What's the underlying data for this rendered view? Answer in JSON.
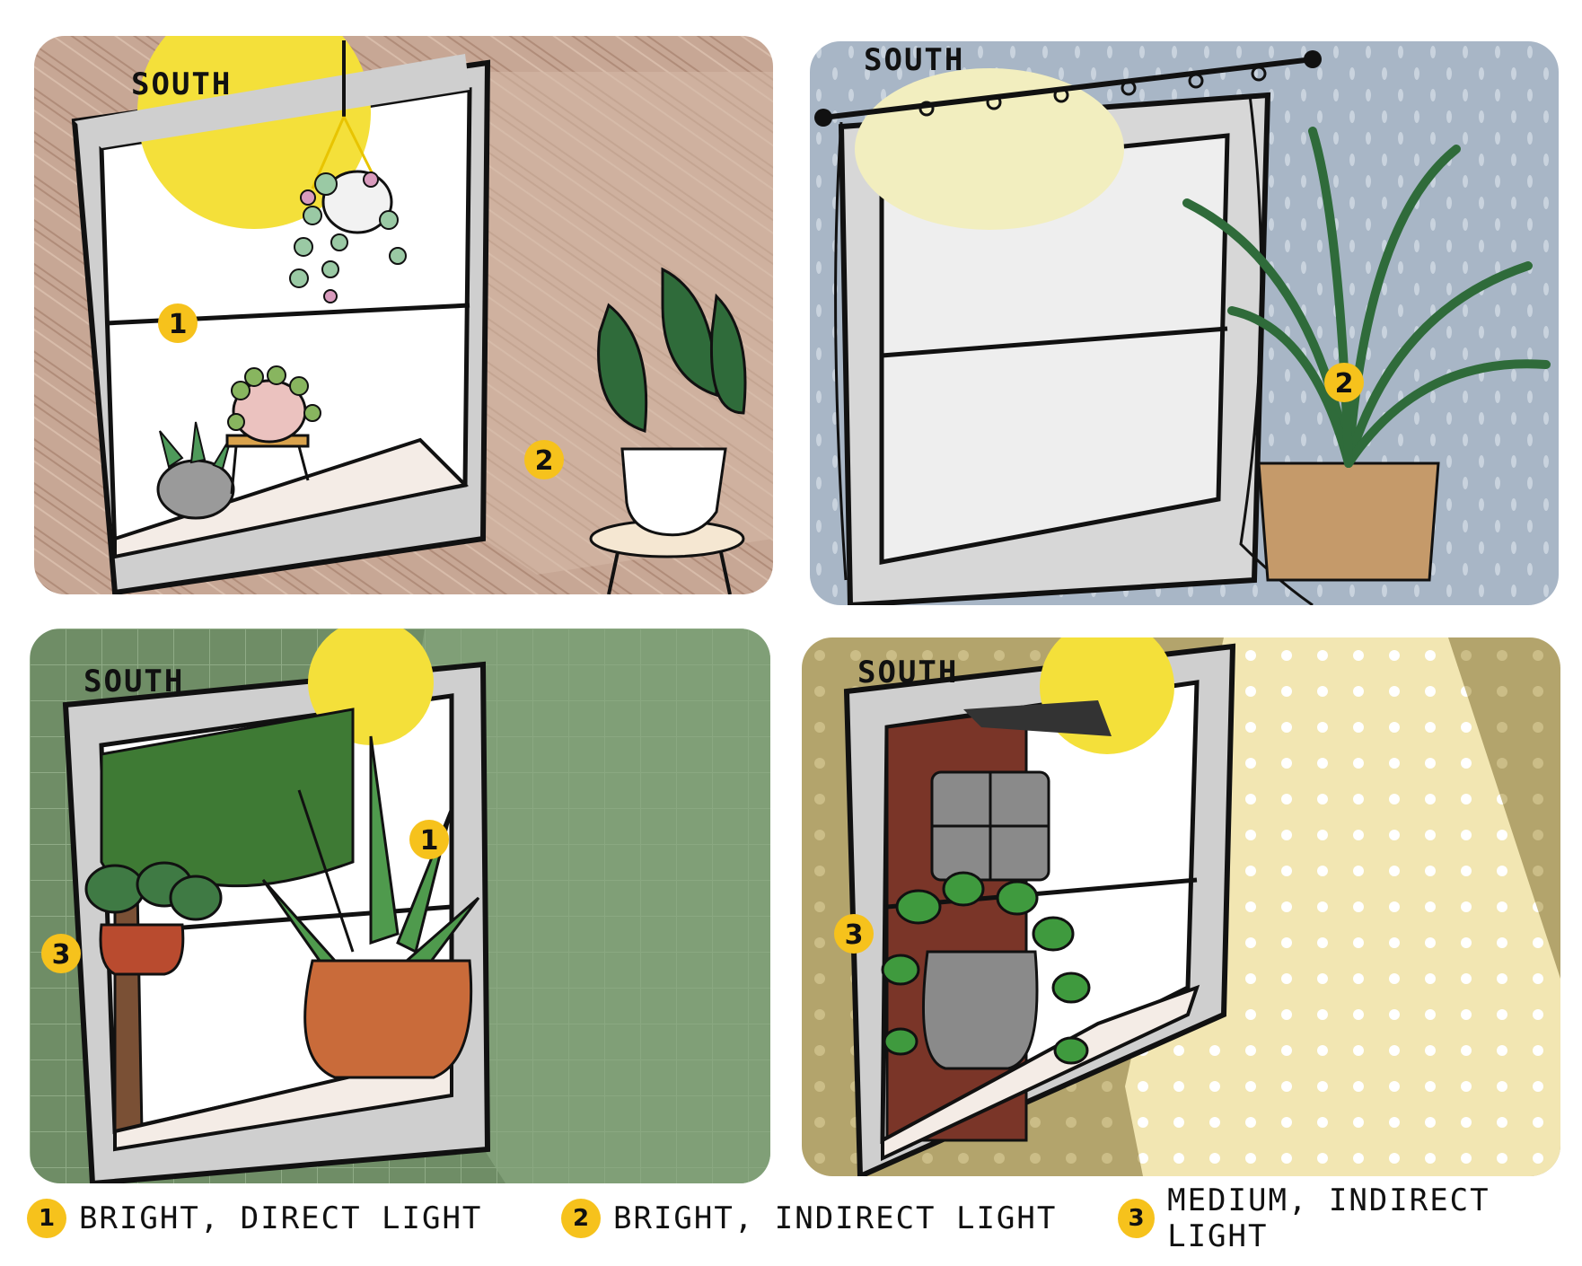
{
  "panels": [
    {
      "direction": "SOUTH",
      "badges": [
        "1",
        "2"
      ]
    },
    {
      "direction": "SOUTH",
      "badges": [
        "2"
      ]
    },
    {
      "direction": "SOUTH",
      "badges": [
        "1",
        "3"
      ]
    },
    {
      "direction": "SOUTH",
      "badges": [
        "3"
      ]
    }
  ],
  "legend": [
    {
      "num": "1",
      "label": "BRIGHT, DIRECT LIGHT"
    },
    {
      "num": "2",
      "label": "BRIGHT, INDIRECT LIGHT"
    },
    {
      "num": "3",
      "label": "MEDIUM, INDIRECT LIGHT"
    }
  ],
  "colors": {
    "badge": "#f6c21c",
    "sun": "#f4e03a",
    "panel1_bg": "#c9a896",
    "panel2_bg": "#a7b5c5",
    "panel3_bg": "#6c8a62",
    "panel4_bg": "#b4a56e"
  }
}
